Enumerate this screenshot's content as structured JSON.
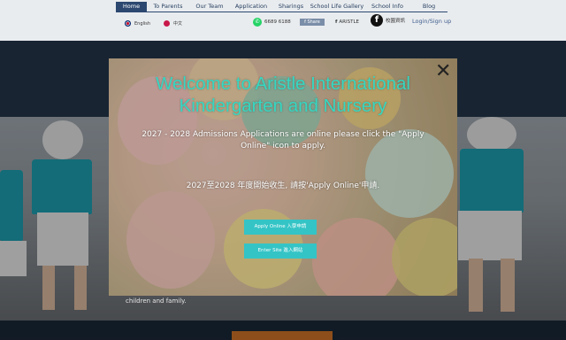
{
  "nav": {
    "items": [
      "Home",
      "To Parents",
      "Our Team",
      "Application",
      "Sharings",
      "School Life Gallery",
      "School Info",
      "Blog"
    ],
    "active_index": 0
  },
  "lang": {
    "english": "English",
    "chinese": "中文"
  },
  "contact": {
    "phone": "6689 6188",
    "facebook_small": "f Share",
    "facebook_name": "ARISTLE",
    "facebook_zh": "校園資訊"
  },
  "login": "Login/Sign up",
  "modal": {
    "title": "Welcome to Aristle International Kindergarten and Nursery",
    "message_en": "2027 - 2028 Admissions Applications are online please click the \"Apply Online\" icon to apply.",
    "message_zh": "2027至2028 年度開始收生, 請按'Apply Online'申請.",
    "apply_button": "Apply Online 入學申請",
    "enter_button": "Enter Site 進入網站",
    "close_symbol": "✕"
  },
  "background_caption": "children and family.",
  "colors": {
    "accent": "#34c4c6",
    "title": "#35d7c2",
    "nav_active": "#2c4870"
  }
}
